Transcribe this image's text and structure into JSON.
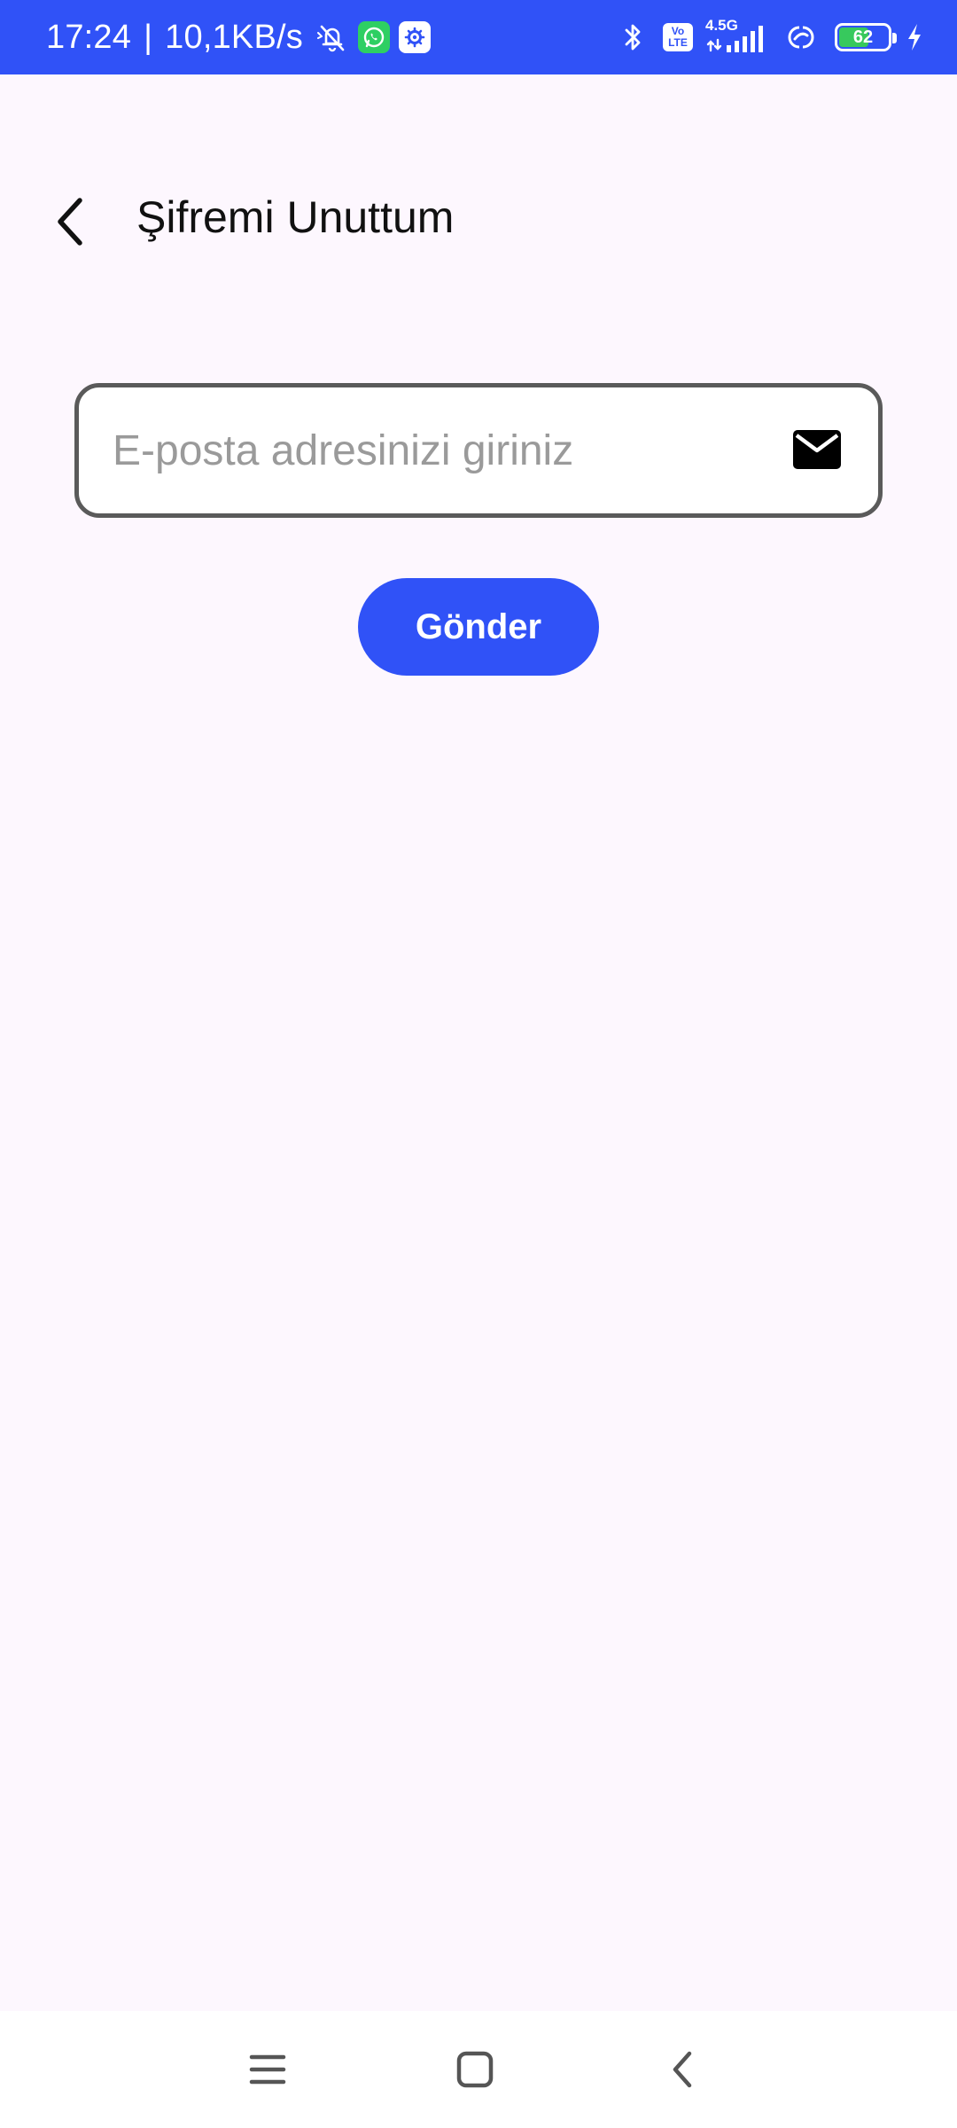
{
  "status_bar": {
    "time": "17:24",
    "separator": "|",
    "net_speed": "10,1KB/s",
    "volte_top": "Vo",
    "volte_bottom": "LTE",
    "network_type": "4.5G",
    "battery_level": "62",
    "battery_fraction": 0.62,
    "icons": [
      "mute-icon",
      "whatsapp-icon",
      "settings-badge-icon",
      "bluetooth-icon",
      "volte-icon",
      "signal-icon",
      "hotspot-icon",
      "battery-icon",
      "charging-icon"
    ],
    "colors": {
      "background": "#3052f7",
      "battery_fill": "#37c95d"
    }
  },
  "app_bar": {
    "back_icon": "chevron-left-icon",
    "title": "Şifremi Unuttum"
  },
  "form": {
    "email_placeholder": "E-posta adresinizi giriniz",
    "email_value": "",
    "email_icon": "mail-icon",
    "submit_label": "Gönder"
  },
  "nav_bar": {
    "buttons": [
      "menu-icon",
      "home-icon",
      "back-icon"
    ]
  },
  "colors": {
    "accent": "#3052f7",
    "page_background": "#fdf7fe"
  }
}
